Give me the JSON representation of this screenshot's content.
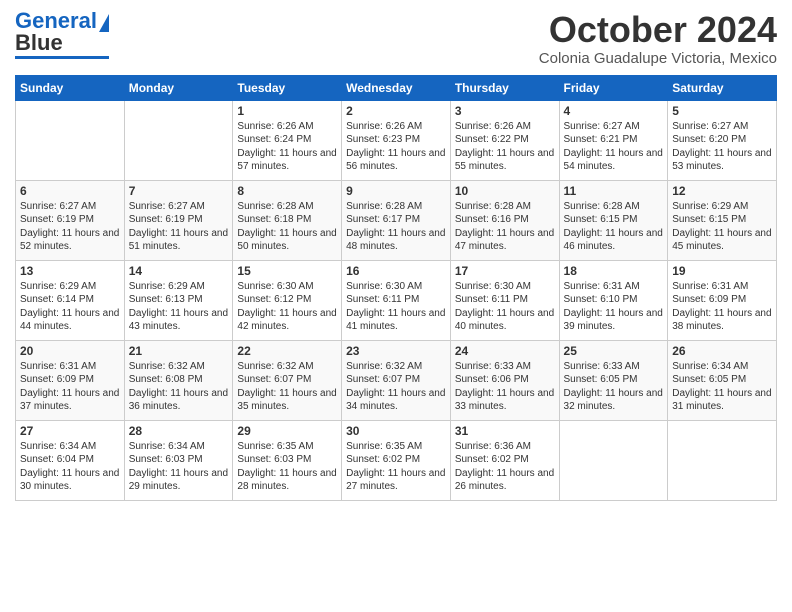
{
  "header": {
    "logo_line1": "General",
    "logo_line2": "Blue",
    "month": "October 2024",
    "location": "Colonia Guadalupe Victoria, Mexico"
  },
  "days_of_week": [
    "Sunday",
    "Monday",
    "Tuesday",
    "Wednesday",
    "Thursday",
    "Friday",
    "Saturday"
  ],
  "weeks": [
    [
      {
        "day": "",
        "info": ""
      },
      {
        "day": "",
        "info": ""
      },
      {
        "day": "1",
        "info": "Sunrise: 6:26 AM\nSunset: 6:24 PM\nDaylight: 11 hours and 57 minutes."
      },
      {
        "day": "2",
        "info": "Sunrise: 6:26 AM\nSunset: 6:23 PM\nDaylight: 11 hours and 56 minutes."
      },
      {
        "day": "3",
        "info": "Sunrise: 6:26 AM\nSunset: 6:22 PM\nDaylight: 11 hours and 55 minutes."
      },
      {
        "day": "4",
        "info": "Sunrise: 6:27 AM\nSunset: 6:21 PM\nDaylight: 11 hours and 54 minutes."
      },
      {
        "day": "5",
        "info": "Sunrise: 6:27 AM\nSunset: 6:20 PM\nDaylight: 11 hours and 53 minutes."
      }
    ],
    [
      {
        "day": "6",
        "info": "Sunrise: 6:27 AM\nSunset: 6:19 PM\nDaylight: 11 hours and 52 minutes."
      },
      {
        "day": "7",
        "info": "Sunrise: 6:27 AM\nSunset: 6:19 PM\nDaylight: 11 hours and 51 minutes."
      },
      {
        "day": "8",
        "info": "Sunrise: 6:28 AM\nSunset: 6:18 PM\nDaylight: 11 hours and 50 minutes."
      },
      {
        "day": "9",
        "info": "Sunrise: 6:28 AM\nSunset: 6:17 PM\nDaylight: 11 hours and 48 minutes."
      },
      {
        "day": "10",
        "info": "Sunrise: 6:28 AM\nSunset: 6:16 PM\nDaylight: 11 hours and 47 minutes."
      },
      {
        "day": "11",
        "info": "Sunrise: 6:28 AM\nSunset: 6:15 PM\nDaylight: 11 hours and 46 minutes."
      },
      {
        "day": "12",
        "info": "Sunrise: 6:29 AM\nSunset: 6:15 PM\nDaylight: 11 hours and 45 minutes."
      }
    ],
    [
      {
        "day": "13",
        "info": "Sunrise: 6:29 AM\nSunset: 6:14 PM\nDaylight: 11 hours and 44 minutes."
      },
      {
        "day": "14",
        "info": "Sunrise: 6:29 AM\nSunset: 6:13 PM\nDaylight: 11 hours and 43 minutes."
      },
      {
        "day": "15",
        "info": "Sunrise: 6:30 AM\nSunset: 6:12 PM\nDaylight: 11 hours and 42 minutes."
      },
      {
        "day": "16",
        "info": "Sunrise: 6:30 AM\nSunset: 6:11 PM\nDaylight: 11 hours and 41 minutes."
      },
      {
        "day": "17",
        "info": "Sunrise: 6:30 AM\nSunset: 6:11 PM\nDaylight: 11 hours and 40 minutes."
      },
      {
        "day": "18",
        "info": "Sunrise: 6:31 AM\nSunset: 6:10 PM\nDaylight: 11 hours and 39 minutes."
      },
      {
        "day": "19",
        "info": "Sunrise: 6:31 AM\nSunset: 6:09 PM\nDaylight: 11 hours and 38 minutes."
      }
    ],
    [
      {
        "day": "20",
        "info": "Sunrise: 6:31 AM\nSunset: 6:09 PM\nDaylight: 11 hours and 37 minutes."
      },
      {
        "day": "21",
        "info": "Sunrise: 6:32 AM\nSunset: 6:08 PM\nDaylight: 11 hours and 36 minutes."
      },
      {
        "day": "22",
        "info": "Sunrise: 6:32 AM\nSunset: 6:07 PM\nDaylight: 11 hours and 35 minutes."
      },
      {
        "day": "23",
        "info": "Sunrise: 6:32 AM\nSunset: 6:07 PM\nDaylight: 11 hours and 34 minutes."
      },
      {
        "day": "24",
        "info": "Sunrise: 6:33 AM\nSunset: 6:06 PM\nDaylight: 11 hours and 33 minutes."
      },
      {
        "day": "25",
        "info": "Sunrise: 6:33 AM\nSunset: 6:05 PM\nDaylight: 11 hours and 32 minutes."
      },
      {
        "day": "26",
        "info": "Sunrise: 6:34 AM\nSunset: 6:05 PM\nDaylight: 11 hours and 31 minutes."
      }
    ],
    [
      {
        "day": "27",
        "info": "Sunrise: 6:34 AM\nSunset: 6:04 PM\nDaylight: 11 hours and 30 minutes."
      },
      {
        "day": "28",
        "info": "Sunrise: 6:34 AM\nSunset: 6:03 PM\nDaylight: 11 hours and 29 minutes."
      },
      {
        "day": "29",
        "info": "Sunrise: 6:35 AM\nSunset: 6:03 PM\nDaylight: 11 hours and 28 minutes."
      },
      {
        "day": "30",
        "info": "Sunrise: 6:35 AM\nSunset: 6:02 PM\nDaylight: 11 hours and 27 minutes."
      },
      {
        "day": "31",
        "info": "Sunrise: 6:36 AM\nSunset: 6:02 PM\nDaylight: 11 hours and 26 minutes."
      },
      {
        "day": "",
        "info": ""
      },
      {
        "day": "",
        "info": ""
      }
    ]
  ]
}
